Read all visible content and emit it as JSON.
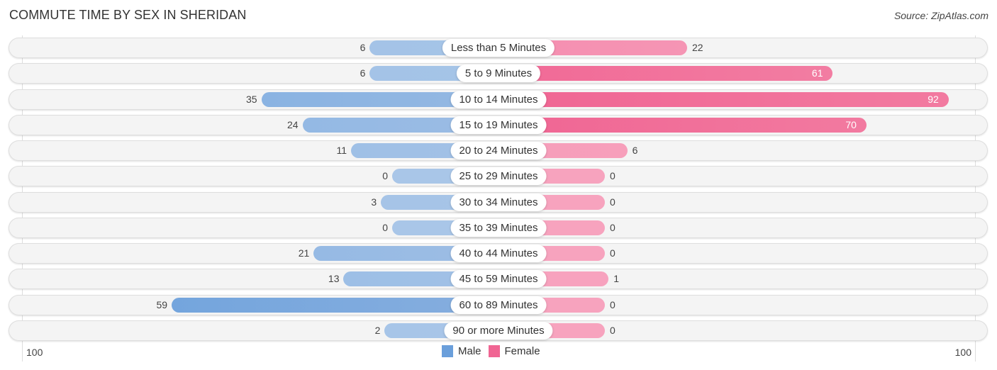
{
  "header": {
    "title": "COMMUTE TIME BY SEX IN SHERIDAN",
    "source": "Source: ZipAtlas.com"
  },
  "colors": {
    "male": "#6a9fdb",
    "male_light": "#a9c6e8",
    "female": "#f06593",
    "female_light": "#f7a3be"
  },
  "chart_data": {
    "type": "bar",
    "orientation": "horizontal-diverging",
    "title": "COMMUTE TIME BY SEX IN SHERIDAN",
    "categories": [
      "Less than 5 Minutes",
      "5 to 9 Minutes",
      "10 to 14 Minutes",
      "15 to 19 Minutes",
      "20 to 24 Minutes",
      "25 to 29 Minutes",
      "30 to 34 Minutes",
      "35 to 39 Minutes",
      "40 to 44 Minutes",
      "45 to 59 Minutes",
      "60 to 89 Minutes",
      "90 or more Minutes"
    ],
    "series": [
      {
        "name": "Male",
        "side": "left",
        "values": [
          6,
          6,
          35,
          24,
          11,
          0,
          3,
          0,
          21,
          13,
          59,
          2
        ]
      },
      {
        "name": "Female",
        "side": "right",
        "values": [
          22,
          61,
          92,
          70,
          6,
          0,
          0,
          0,
          0,
          1,
          0,
          0
        ]
      }
    ],
    "axis": {
      "left_label": "100",
      "right_label": "100",
      "range": [
        0,
        100
      ]
    },
    "legend": {
      "placement": "bottom-center",
      "entries": [
        "Male",
        "Female"
      ]
    },
    "xlabel": "",
    "ylabel": ""
  }
}
